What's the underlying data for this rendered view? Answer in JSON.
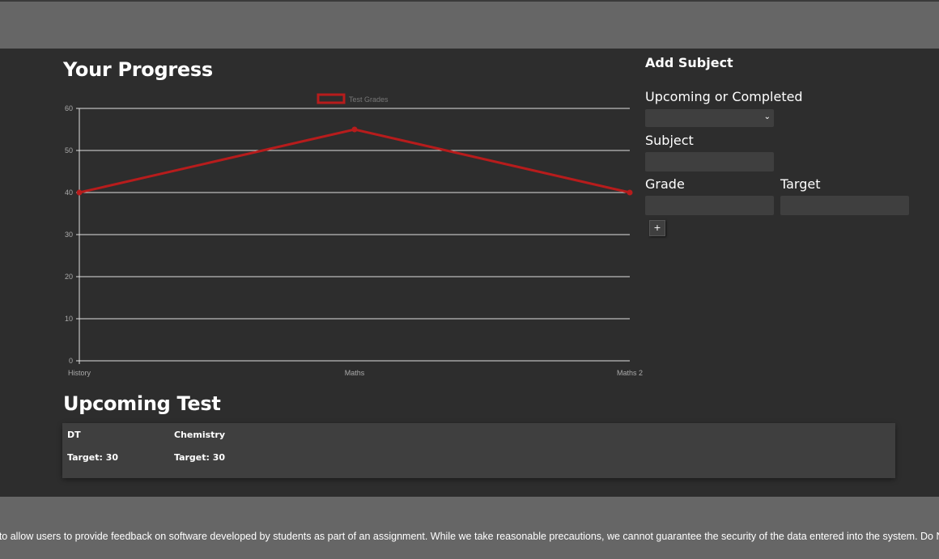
{
  "progress": {
    "title": "Your Progress"
  },
  "chart_data": {
    "type": "line",
    "categories": [
      "History",
      "Maths",
      "Maths 2"
    ],
    "series": [
      {
        "name": "Test Grades",
        "values": [
          40,
          55,
          40
        ],
        "color": "#b71c1c"
      }
    ],
    "ylim": [
      0,
      60
    ],
    "yticks": [
      0,
      10,
      20,
      30,
      40,
      50,
      60
    ],
    "grid": true,
    "legend": "top-center"
  },
  "form": {
    "title": "Add Subject",
    "status_label": "Upcoming or Completed",
    "status_value": "",
    "subject_label": "Subject",
    "subject_value": "",
    "grade_label": "Grade",
    "grade_value": "",
    "target_label": "Target",
    "target_value": "",
    "add_label": "+"
  },
  "upcoming": {
    "title": "Upcoming Test",
    "tests": [
      {
        "name": "DT",
        "target": "Target: 30"
      },
      {
        "name": "Chemistry",
        "target": "Target: 30"
      }
    ]
  },
  "footer": {
    "text": "am to allow users to provide feedback on software developed by students as part of an assignment. While we take reasonable precautions, we cannot guarantee the security of the data entered into the system. Do NOT e"
  },
  "colors": {
    "background": "#2d2d2d",
    "bar": "#666666",
    "panel": "#3f3f3f",
    "accent": "#b71c1c"
  }
}
